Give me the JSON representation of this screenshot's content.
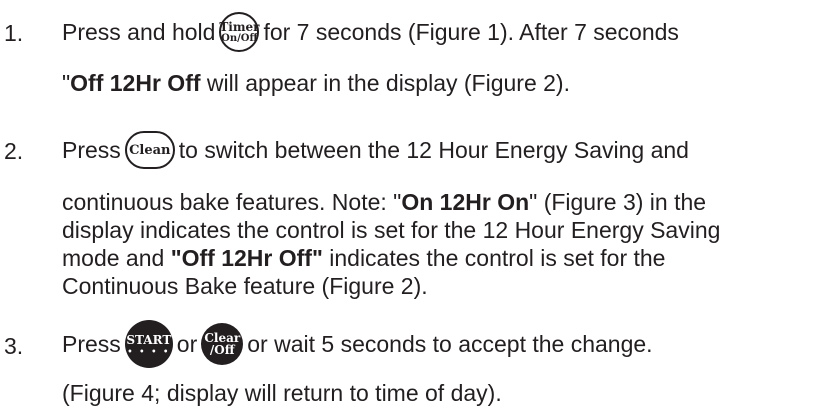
{
  "steps": [
    {
      "number": "1.",
      "line1_before": "Press and hold",
      "button_top": "Timer",
      "button_bottom": "On/Off",
      "line1_after": "for 7 seconds (Figure 1). After 7 seconds",
      "line2_quote": "\"",
      "line2_bold": "Off 12Hr Off",
      "line2_after": " will appear in the display (Figure 2)."
    },
    {
      "number": "2.",
      "line1_before": "Press",
      "button_label": "Clean",
      "line1_after": "to switch between the 12 Hour Energy Saving and",
      "line2": "continuous bake features. Note: \"",
      "line2_bold": "On 12Hr On",
      "line2_after": "\" (Figure 3) in the",
      "line3": "display indicates the control is set for the 12 Hour Energy Saving",
      "line4_before": "mode and ",
      "line4_bold": "\"Off 12Hr Off\"",
      "line4_after": " indicates the control is set for the",
      "line5": "Continuous Bake feature (Figure 2)."
    },
    {
      "number": "3.",
      "line1_before": "Press",
      "start_label": "START",
      "start_dots": "• • • •",
      "or_text": "or",
      "clear_top": "Clear",
      "clear_bottom": "/Off",
      "line1_after": "or wait 5 seconds to accept the change.",
      "line2": "(Figure 4; display will return to time of day)."
    }
  ]
}
